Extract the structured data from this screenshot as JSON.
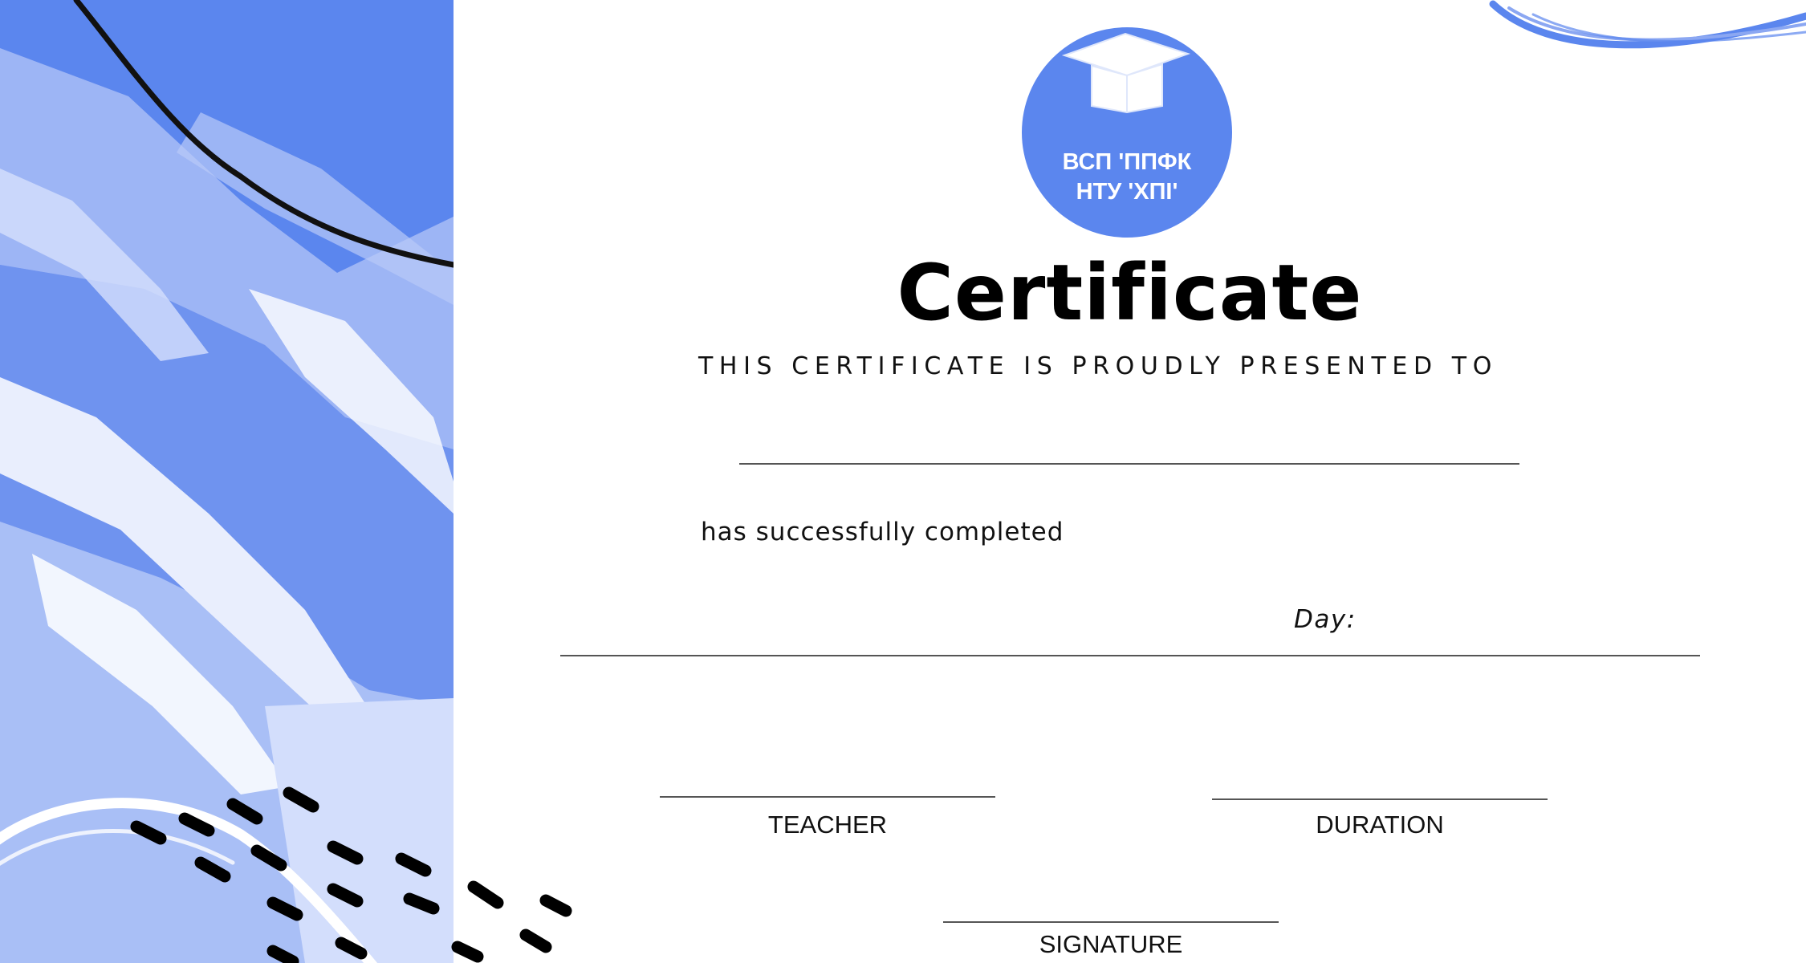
{
  "colors": {
    "accent_blue": "#5b86ee",
    "mid_blue": "#8ba7f2",
    "light_blue": "#c9d6fb",
    "ink": "#000000",
    "rule": "#555555"
  },
  "emblem": {
    "icon": "graduation-cap-icon",
    "line1": "ВСП 'ППФК",
    "line2": "НТУ 'ХПІ'"
  },
  "certificate": {
    "title": "Certificate",
    "presented_to": "THIS CERTIFICATE IS PROUDLY PRESENTED TO",
    "recipient_name": "",
    "completed_text": "has successfully completed",
    "day_label": "Day:",
    "teacher_label": "TEACHER",
    "duration_label": "DURATION",
    "signature_label": "SIGNATURE"
  }
}
